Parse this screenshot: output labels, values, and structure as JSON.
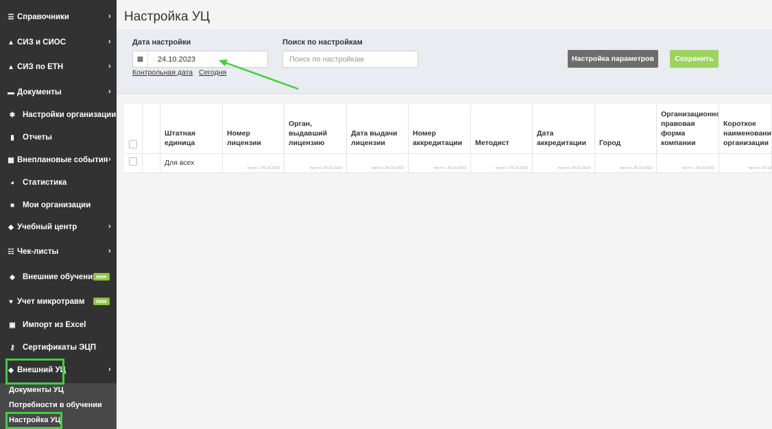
{
  "sidebar": {
    "items": [
      {
        "label": "Справочники",
        "icon": "list-icon",
        "chevron": true
      },
      {
        "label": "СИЗ и СИОС",
        "icon": "helmet-icon",
        "chevron": true
      },
      {
        "label": "СИЗ по ЕТН",
        "icon": "helmet-icon",
        "chevron": true
      },
      {
        "label": "Документы",
        "icon": "folder-icon",
        "chevron": true
      },
      {
        "label": "Настройки организации",
        "icon": "gear-icon",
        "chevron": false
      },
      {
        "label": "Отчеты",
        "icon": "file-icon",
        "chevron": false
      },
      {
        "label": "Внеплановые события",
        "icon": "calendar-icon",
        "chevron": true
      },
      {
        "label": "Статистика",
        "icon": "pie-chart-icon",
        "chevron": false
      },
      {
        "label": "Мои организации",
        "icon": "briefcase-icon",
        "chevron": false
      },
      {
        "label": "Учебный центр",
        "icon": "graduation-cap-icon",
        "chevron": true
      },
      {
        "label": "Чек-листы",
        "icon": "checklist-icon",
        "chevron": true
      },
      {
        "label": "Внешние обучения",
        "icon": "graduation-cap-icon",
        "badge": "new"
      },
      {
        "label": "Учет микротравм",
        "icon": "heartbeat-icon",
        "badge": "new"
      },
      {
        "label": "Импорт из Excel",
        "icon": "excel-icon",
        "chevron": false
      },
      {
        "label": "Сертификаты ЭЦП",
        "icon": "key-icon",
        "chevron": false
      },
      {
        "label": "Внешний УЦ",
        "icon": "graduation-cap-icon",
        "chevron": true
      }
    ],
    "subitems": [
      "Документы УЦ",
      "Потребности в обучении",
      "Настройка УЦ"
    ]
  },
  "page": {
    "title": "Настройка УЦ",
    "date_label": "Дата настройки",
    "date_value": "24.10.2023",
    "control_date_link": "Контрольная дата",
    "today_link": "Сегодня",
    "search_label": "Поиск по настройкам",
    "search_placeholder": "Поиск по настройкам",
    "params_button": "Настройка параметров",
    "save_button": "Сохранить"
  },
  "table": {
    "headers": [
      "Штатная\nединица",
      "Номер\nлицензии",
      "Орган,\nвыдавший\nлицензию",
      "Дата выдачи\nлицензии",
      "Номер\nаккредитации",
      "Методист",
      "Дата\nаккредитации",
      "Город",
      "Организационно-\nправовая\nформа\nкомпании",
      "Короткое\nнаименование\nорганизации"
    ],
    "row": {
      "unit": "Для всех",
      "empty_note": "пусто с 24.10.2023"
    }
  },
  "colors": {
    "sidebar_bg": "#323232",
    "highlight": "#3fcf3f",
    "save_button": "#9ed35f",
    "params_button": "#6d6d6d",
    "badge": "#8cc63f"
  }
}
